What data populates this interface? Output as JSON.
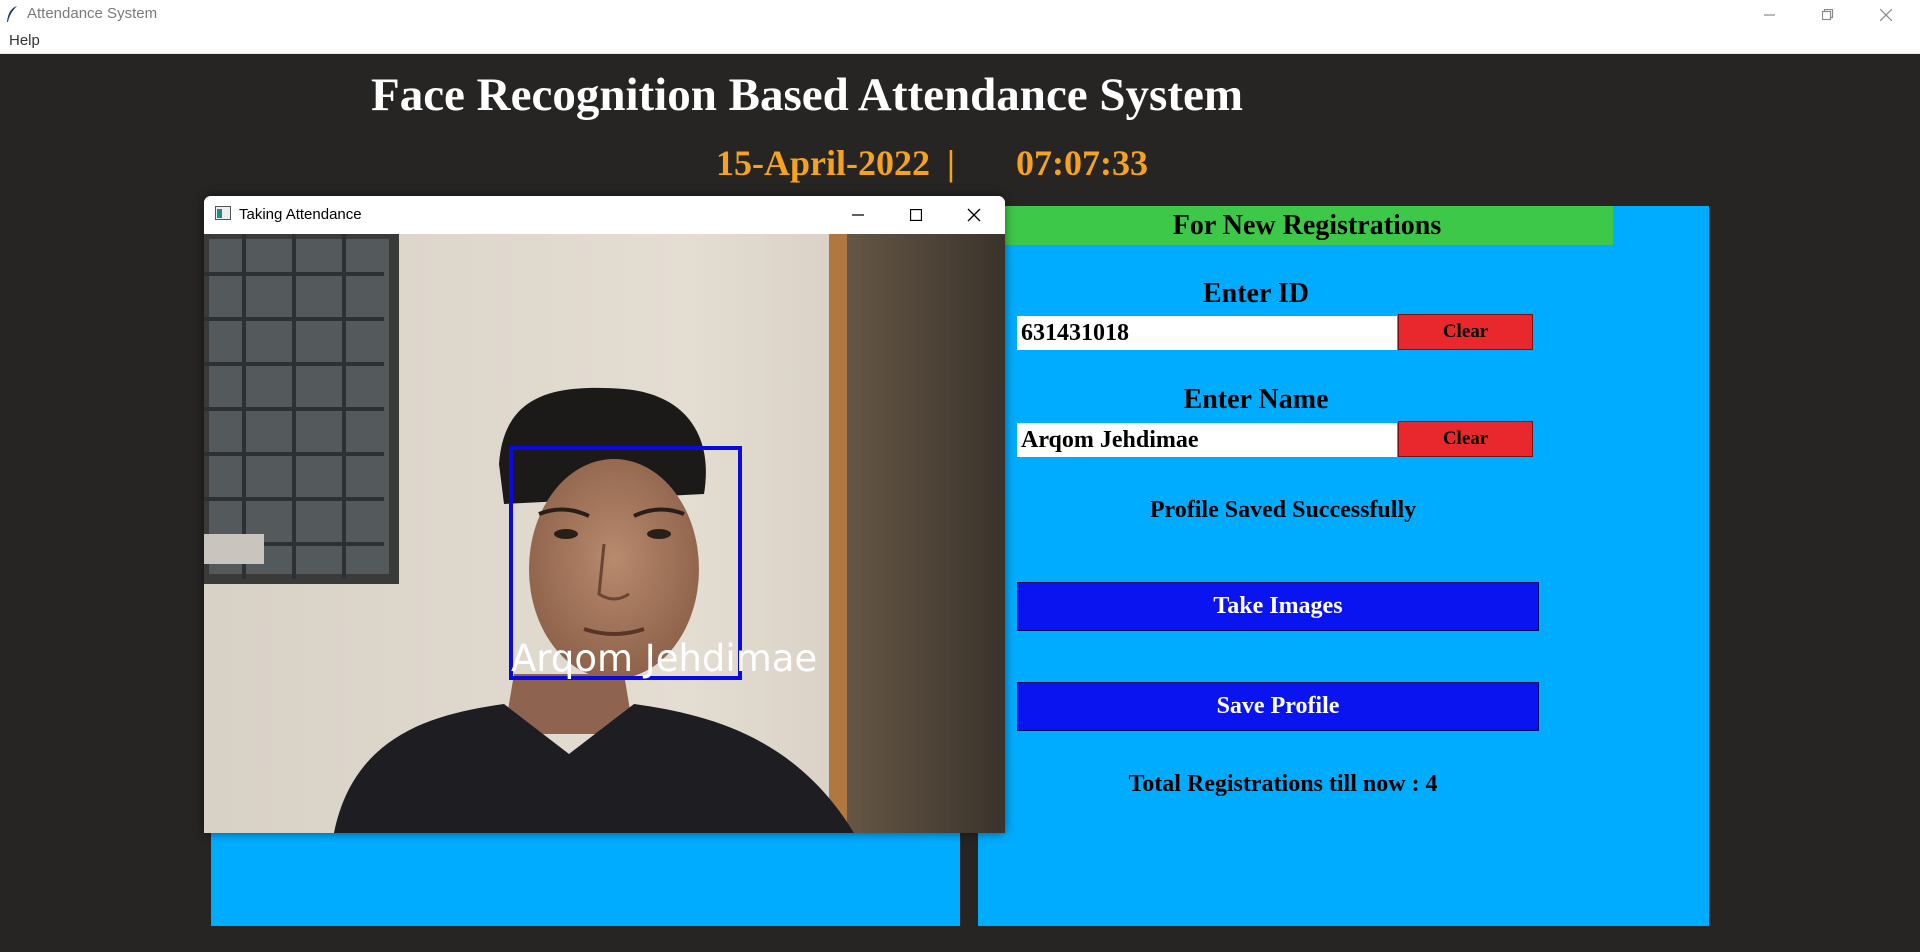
{
  "window": {
    "title": "Attendance System"
  },
  "menu": {
    "items": [
      "Help"
    ]
  },
  "header": {
    "title": "Face Recognition Based Attendance System",
    "date": "15-April-2022",
    "separator": "|",
    "time": "07:07:33"
  },
  "registration": {
    "header": "For New Registrations",
    "id_label": "Enter ID",
    "id_value": "631431018",
    "name_label": "Enter Name",
    "name_value": "Arqom Jehdimae",
    "clear_label": "Clear",
    "status_message": "Profile Saved Successfully",
    "take_images_label": "Take Images",
    "save_profile_label": "Save Profile",
    "total_registrations": "Total Registrations till now  : 4"
  },
  "camera_window": {
    "title": "Taking Attendance",
    "detected_name": "Arqom Jehdimae"
  },
  "colors": {
    "background": "#262523",
    "panel": "#00acff",
    "header_green": "#3ec84a",
    "clear_red": "#e8282c",
    "button_blue": "#0a14f0",
    "date_orange": "#f5a21f"
  }
}
